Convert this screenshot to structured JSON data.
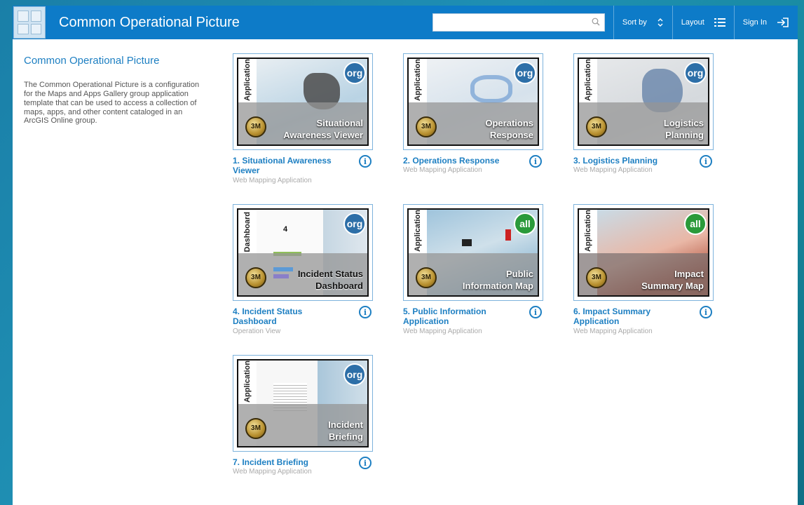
{
  "header": {
    "title": "Common Operational Picture",
    "search_placeholder": "",
    "sort_label": "Sort by",
    "layout_label": "Layout",
    "signin_label": "Sign In"
  },
  "sidebar": {
    "heading": "Common Operational Picture",
    "description": "The Common Operational Picture is a configuration for the Maps and Apps Gallery group application template that can be used to access a collection of maps, apps, and other content cataloged in an ArcGIS Online group."
  },
  "items": [
    {
      "title": "1. Situational Awareness Viewer",
      "type": "Web Mapping Application",
      "tab": "Application",
      "overlay": [
        "Situational",
        "Awareness Viewer"
      ],
      "badge": "org",
      "badge_color": "#2d6fa8",
      "seal": "3M"
    },
    {
      "title": "2. Operations Response",
      "type": "Web Mapping Application",
      "tab": "Application",
      "overlay": [
        "Operations",
        "Response"
      ],
      "badge": "org",
      "badge_color": "#2d6fa8",
      "seal": "3M"
    },
    {
      "title": "3. Logistics Planning",
      "type": "Web Mapping Application",
      "tab": "Application",
      "overlay": [
        "Logistics",
        "Planning"
      ],
      "badge": "org",
      "badge_color": "#2d6fa8",
      "seal": "3M"
    },
    {
      "title": "4. Incident Status Dashboard",
      "type": "Operation View",
      "tab": "Dashboard",
      "overlay": [
        "Incident Status",
        "Dashboard"
      ],
      "badge": "org",
      "badge_color": "#2d6fa8",
      "seal": "3M",
      "dash_value": "4"
    },
    {
      "title": "5. Public Information Application",
      "type": "Web Mapping Application",
      "tab": "Application",
      "overlay": [
        "Public",
        "Information Map"
      ],
      "badge": "all",
      "badge_color": "#2a9a3a",
      "seal": "3M"
    },
    {
      "title": "6. Impact Summary Application",
      "type": "Web Mapping Application",
      "tab": "Application",
      "overlay": [
        "Impact",
        "Summary Map"
      ],
      "badge": "all",
      "badge_color": "#2a9a3a",
      "seal": "3M"
    },
    {
      "title": "7. Incident Briefing",
      "type": "Web Mapping Application",
      "tab": "Application",
      "overlay": [
        "Incident",
        "Briefing"
      ],
      "badge": "org",
      "badge_color": "#2d6fa8",
      "seal": "3M"
    }
  ],
  "info_glyph": "i"
}
